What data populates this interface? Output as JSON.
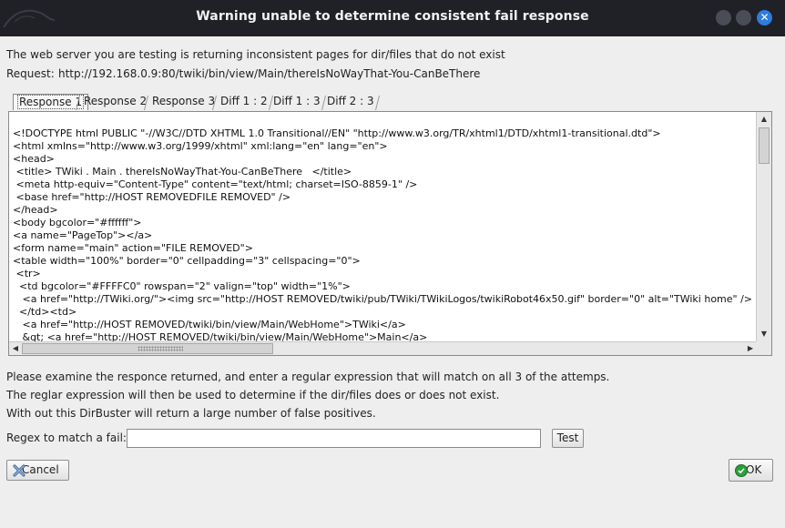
{
  "window": {
    "title": "Warning unable to determine consistent fail response"
  },
  "message": {
    "line1": "The web server you are testing is returning inconsistent pages for dir/files that do not exist",
    "request_label": "Request:",
    "request_url": "http://192.168.0.9:80/twiki/bin/view/Main/thereIsNoWayThat-You-CanBeThere"
  },
  "tabs": [
    {
      "label": "Response 1",
      "active": true
    },
    {
      "label": "Response 2",
      "active": false
    },
    {
      "label": "Response 3",
      "active": false
    },
    {
      "label": "Diff 1 : 2",
      "active": false
    },
    {
      "label": "Diff 1 : 3",
      "active": false
    },
    {
      "label": "Diff 2 : 3",
      "active": false
    }
  ],
  "response_lines": [
    "<!DOCTYPE html PUBLIC \"-//W3C//DTD XHTML 1.0 Transitional//EN\" \"http://www.w3.org/TR/xhtml1/DTD/xhtml1-transitional.dtd\">",
    "<html xmlns=\"http://www.w3.org/1999/xhtml\" xml:lang=\"en\" lang=\"en\">",
    "<head>",
    " <title> TWiki . Main . thereIsNoWayThat-You-CanBeThere   </title>",
    " <meta http-equiv=\"Content-Type\" content=\"text/html; charset=ISO-8859-1\" />",
    " <base href=\"http://HOST REMOVEDFILE REMOVED\" />",
    "</head>",
    "<body bgcolor=\"#ffffff\">",
    "<a name=\"PageTop\"></a>",
    "<form name=\"main\" action=\"FILE REMOVED\">",
    "<table width=\"100%\" border=\"0\" cellpadding=\"3\" cellspacing=\"0\">",
    " <tr>",
    "  <td bgcolor=\"#FFFFC0\" rowspan=\"2\" valign=\"top\" width=\"1%\">",
    "   <a href=\"http://TWiki.org/\"><img src=\"http://HOST REMOVED/twiki/pub/TWiki/TWikiLogos/twikiRobot46x50.gif\" border=\"0\" alt=\"TWiki home\" />",
    "  </td><td>",
    "   <a href=\"http://HOST REMOVED/twiki/bin/view/Main/WebHome\">TWiki</a>",
    "   &gt; <a href=\"http://HOST REMOVED/twiki/bin/view/Main/WebHome\">Main</a>"
  ],
  "instructions": {
    "line1": "Please examine the responce returned, and enter a regular expression that will match on all 3 of the attemps.",
    "line2": "The reglar expression will then be used to determine if the dir/files does or does not exist.",
    "line3": "With out this DirBuster will return a large number of false positives."
  },
  "regex": {
    "label": "Regex to match a fail:",
    "value": "",
    "test_label": "Test"
  },
  "buttons": {
    "cancel_label": "Cancel",
    "ok_label": "OK"
  }
}
